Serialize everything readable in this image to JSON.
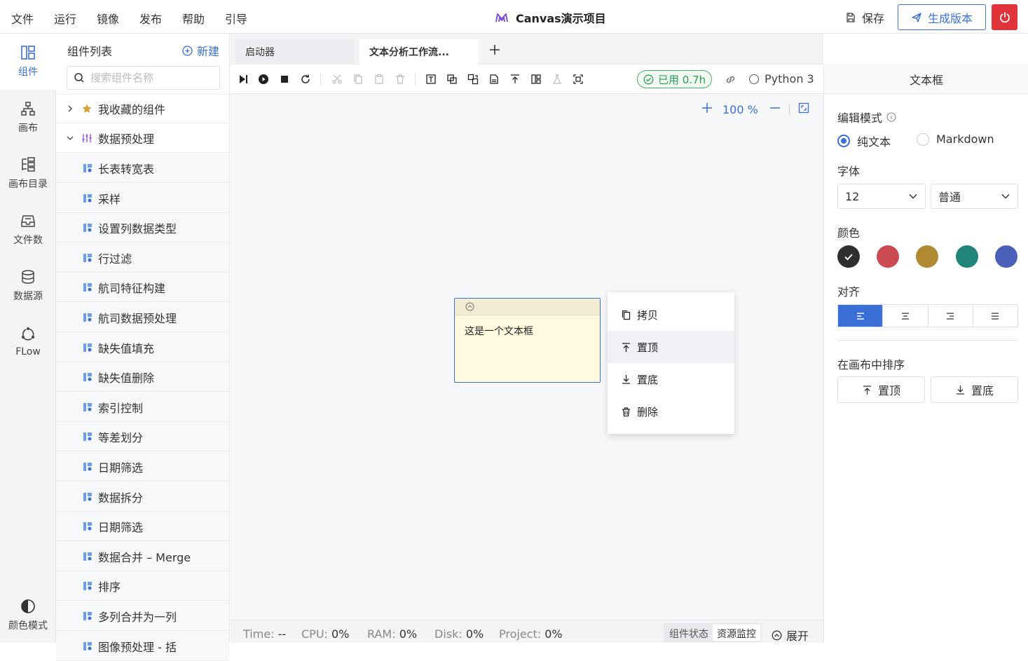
{
  "menu": [
    "文件",
    "运行",
    "镜像",
    "发布",
    "帮助",
    "引导"
  ],
  "app_title": "Canvas演示项目",
  "header": {
    "save_label": "保存",
    "generate_label": "生成版本"
  },
  "rail": {
    "items": [
      "组件",
      "画布",
      "画布目录",
      "文件数",
      "数据源",
      "FLow"
    ],
    "bottom": "颜色模式"
  },
  "components": {
    "title": "组件列表",
    "new_label": "新建",
    "search_placeholder": "搜索组件名称",
    "groups": [
      "我收藏的组件",
      "数据预处理"
    ],
    "items": [
      "长表转宽表",
      "采样",
      "设置列数据类型",
      "行过滤",
      "航司特征构建",
      "航司数据预处理",
      "缺失值填充",
      "缺失值删除",
      "索引控制",
      "等差划分",
      "日期筛选",
      "数据拆分",
      "日期筛选",
      "数据合并 – Merge",
      "排序",
      "多列合并为一列",
      "图像预处理 - 括"
    ]
  },
  "tabs": [
    "启动器",
    "文本分析工作流..."
  ],
  "toolbar": {
    "used": "已用 0.7h",
    "kernel": "Python 3"
  },
  "canvas": {
    "zoom": "100 %",
    "node_text": "这是一个文本框",
    "context_menu": [
      "拷贝",
      "置顶",
      "置底",
      "删除"
    ]
  },
  "status": {
    "time_label": "Time:",
    "time_value": "--",
    "cpu_label": "CPU:",
    "cpu_value": "0%",
    "ram_label": "RAM:",
    "ram_value": "0%",
    "disk_label": "Disk:",
    "disk_value": "0%",
    "project_label": "Project:",
    "project_value": "0%",
    "toggle": [
      "组件状态",
      "资源监控"
    ],
    "expand": "展开"
  },
  "props": {
    "title": "文本框",
    "edit_mode_label": "编辑模式",
    "mode_plain": "纯文本",
    "mode_markdown": "Markdown",
    "font_label": "字体",
    "font_size": "12",
    "font_weight": "普通",
    "color_label": "颜色",
    "colors": [
      "#2f2f2f",
      "#c94a4f",
      "#b08a30",
      "#21857a",
      "#4a5fb8"
    ],
    "align_label": "对齐",
    "order_label": "在画布中排序",
    "order_top": "置顶",
    "order_bottom": "置底"
  }
}
